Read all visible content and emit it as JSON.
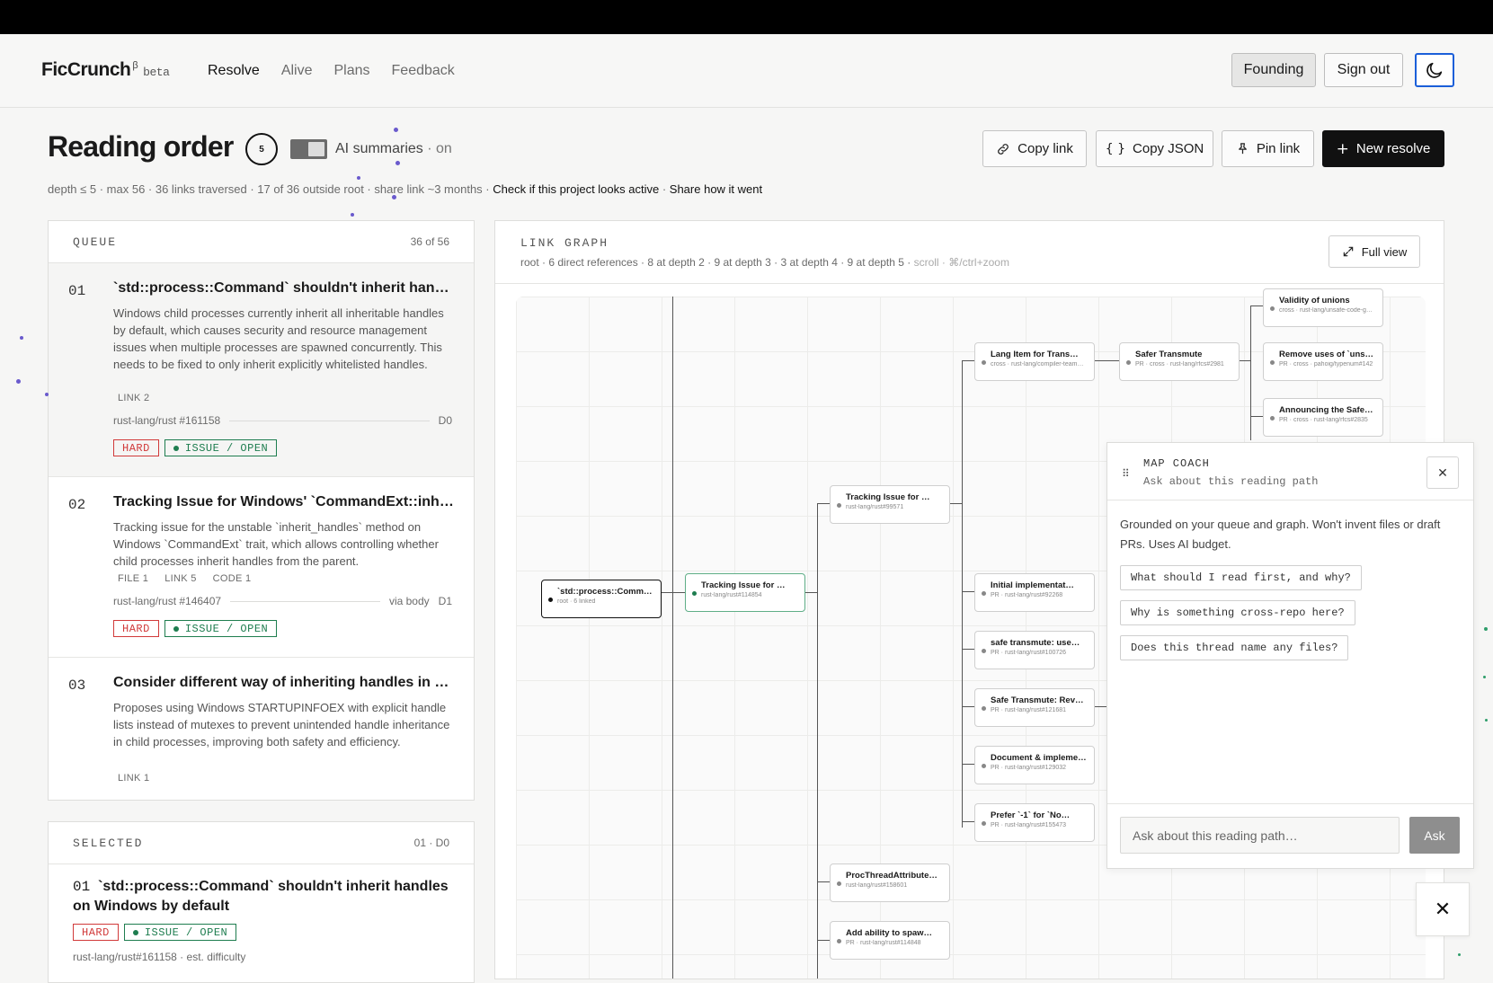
{
  "header": {
    "brand": "FicCrunch",
    "brand_sup": "β",
    "brand_badge": "beta",
    "nav": [
      "Resolve",
      "Alive",
      "Plans",
      "Feedback"
    ],
    "founding_label": "Founding",
    "signout_label": "Sign out",
    "theme_icon": "moon-icon"
  },
  "page": {
    "title": "Reading order",
    "depth_badge": "5",
    "ai_label": "AI summaries",
    "ai_state": "· on",
    "meta": "depth ≤ 5 · max 56 · 36 links traversed · 17 of 36 outside root · share link ~3 months · ",
    "meta_link_active": "Check if this project looks active",
    "meta_sep": " · ",
    "meta_link_share": "Share how it went"
  },
  "actions": {
    "copy_link": "Copy link",
    "copy_json": "Copy JSON",
    "pin_link": "Pin link",
    "new_resolve": "New resolve"
  },
  "queue": {
    "title": "QUEUE",
    "count": "36 of 56",
    "items": [
      {
        "num": "01",
        "title": "`std::process::Command` shouldn't inherit handles on Windows by default",
        "desc": "Windows child processes currently inherit all inheritable handles by default, which causes security and resource management issues when multiple processes are spawned concurrently. This needs to be fixed to only inherit explicitly whitelisted handles.",
        "links": [
          "LINK 2"
        ],
        "repo": "rust-lang/rust #161158",
        "via": "",
        "depth": "D0",
        "tags": [
          "HARD",
          "ISSUE / OPEN"
        ]
      },
      {
        "num": "02",
        "title": "Tracking Issue for Windows' `CommandExt::inherit_handles`",
        "desc": "Tracking issue for the unstable `inherit_handles` method on Windows `CommandExt` trait, which allows controlling whether child processes inherit handles from the parent.",
        "links": [
          "FILE 1",
          "LINK 5",
          "CODE 1"
        ],
        "repo": "rust-lang/rust #146407",
        "via": "via body",
        "depth": "D1",
        "tags": [
          "HARD",
          "ISSUE / OPEN"
        ]
      },
      {
        "num": "03",
        "title": "Consider different way of inheriting handles in child processes",
        "desc": "Proposes using Windows STARTUPINFOEX with explicit handle lists instead of mutexes to prevent unintended handle inheritance in child processes, improving both safety and efficiency.",
        "links": [
          "LINK 1"
        ],
        "repo": "",
        "via": "",
        "depth": "",
        "tags": []
      }
    ]
  },
  "selected": {
    "title": "SELECTED",
    "count": "01 · D0",
    "num": "01",
    "name": "`std::process::Command` shouldn't inherit handles on Windows by default",
    "tags": [
      "HARD",
      "ISSUE / OPEN"
    ],
    "repo": "rust-lang/rust#161158 · est. difficulty"
  },
  "graph": {
    "title": "LINK GRAPH",
    "sub": "root · 6 direct references · 8 at depth 2 · 9 at depth 3 · 3 at depth 4 · 9 at depth 5 · ",
    "sub_hint": "scroll · ⌘/ctrl+zoom",
    "full_view": "Full view",
    "nodes": [
      {
        "id": "root",
        "title": "`std::process::Comm…",
        "sub": "root · 6 linked"
      },
      {
        "id": "n1",
        "title": "Tracking Issue for …",
        "sub": "rust-lang/rust#114854"
      },
      {
        "id": "n2",
        "title": "Tracking Issue for …",
        "sub": "rust-lang/rust#99571"
      },
      {
        "id": "n3",
        "title": "ProcThreadAttribute…",
        "sub": "rust-lang/rust#158601"
      },
      {
        "id": "n4",
        "title": "Add ability to spaw…",
        "sub": "PR · rust-lang/rust#114848"
      },
      {
        "id": "n5",
        "title": "Lang Item for Trans…",
        "sub": "cross · rust-lang/compiler-team…"
      },
      {
        "id": "n6",
        "title": "Initial implementat…",
        "sub": "PR · rust-lang/rust#92268"
      },
      {
        "id": "n7",
        "title": "safe transmute: use…",
        "sub": "PR · rust-lang/rust#100726"
      },
      {
        "id": "n8",
        "title": "Safe Transmute: Rev…",
        "sub": "PR · rust-lang/rust#121681"
      },
      {
        "id": "n9",
        "title": "Document & implemen…",
        "sub": "PR · rust-lang/rust#129032"
      },
      {
        "id": "n10",
        "title": "Prefer `-1` for `No…",
        "sub": "PR · rust-lang/rust#155473"
      },
      {
        "id": "n11",
        "title": "Safer Transmute",
        "sub": "PR · cross · rust-lang/rfcs#2981"
      },
      {
        "id": "n12",
        "title": "Validity of unions",
        "sub": "cross · rust-lang/unsafe-code-g…"
      },
      {
        "id": "n13",
        "title": "Remove uses of `uns…",
        "sub": "PR · cross · pahoig/typenum#142"
      },
      {
        "id": "n14",
        "title": "Announcing the Safe…",
        "sub": "PR · cross · rust-lang/rfcs#2835"
      }
    ]
  },
  "coach": {
    "title": "MAP COACH",
    "subtitle": "Ask about this reading path",
    "intro": "Grounded on your queue and graph. Won't invent files or draft PRs. Uses AI budget.",
    "chips": [
      "What should I read first, and why?",
      "Why is something cross-repo here?",
      "Does this thread name any files?"
    ],
    "placeholder": "Ask about this reading path…",
    "ask_label": "Ask"
  },
  "colors": {
    "accent_blue": "#1b5fd9",
    "hard_red": "#d13a3a",
    "issue_green": "#1e7d4f",
    "dark_button": "#111111"
  }
}
